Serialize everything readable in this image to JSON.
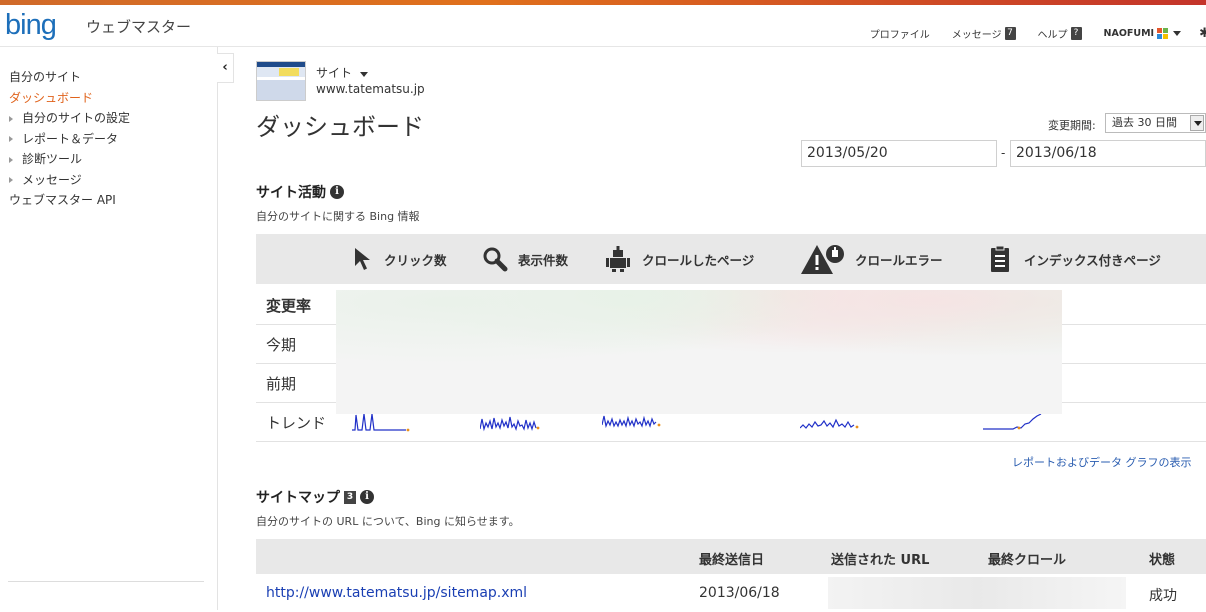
{
  "header": {
    "logo": "bing",
    "product": "ウェブマスター",
    "nav": [
      {
        "label": "プロファイル"
      },
      {
        "label": "メッセージ",
        "badge": "7"
      },
      {
        "label": "ヘルプ",
        "badge": "?"
      },
      {
        "label": "NAOFUMI"
      }
    ],
    "colors": {
      "logo": "#1d6fba",
      "accent": "#e0631c"
    }
  },
  "sidebar": {
    "items": [
      {
        "label": "自分のサイト",
        "expandable": false,
        "active": false
      },
      {
        "label": "ダッシュボード",
        "expandable": false,
        "active": true
      },
      {
        "label": "自分のサイトの設定",
        "expandable": true,
        "active": false
      },
      {
        "label": "レポート＆データ",
        "expandable": true,
        "active": false
      },
      {
        "label": "診断ツール",
        "expandable": true,
        "active": false
      },
      {
        "label": "メッセージ",
        "expandable": true,
        "active": false
      },
      {
        "label": "ウェブマスター API",
        "expandable": false,
        "active": false
      }
    ],
    "collapse_icon": "chevron-left-icon"
  },
  "site": {
    "selector_label": "サイト",
    "url": "www.tatematsu.jp"
  },
  "page_title": "ダッシュボード",
  "period": {
    "label": "変更期間:",
    "selected": "過去 30 日間",
    "from": "2013/05/20",
    "separator": "-",
    "to": "2013/06/18"
  },
  "site_activity": {
    "title": "サイト活動",
    "description": "自分のサイトに関する Bing 情報",
    "metrics": [
      {
        "label": "クリック数",
        "icon": "cursor-icon"
      },
      {
        "label": "表示件数",
        "icon": "magnifier-icon"
      },
      {
        "label": "クロールしたページ",
        "icon": "robot-icon"
      },
      {
        "label": "クロールエラー",
        "icon": "warning-icon"
      },
      {
        "label": "インデックス付きページ",
        "icon": "document-icon"
      }
    ],
    "rows": [
      "変更率",
      "今期",
      "前期",
      "トレンド"
    ],
    "report_link": "レポートおよびデータ グラフの表示"
  },
  "sitemaps": {
    "title": "サイトマップ",
    "count": "3",
    "description": "自分のサイトの URL について、Bing に知らせます。",
    "columns": [
      "最終送信日",
      "送信された URL",
      "最終クロール",
      "状態"
    ],
    "rows": [
      {
        "url": "http://www.tatematsu.jp/sitemap.xml",
        "last_submitted": "2013/06/18",
        "status": "成功"
      }
    ]
  }
}
